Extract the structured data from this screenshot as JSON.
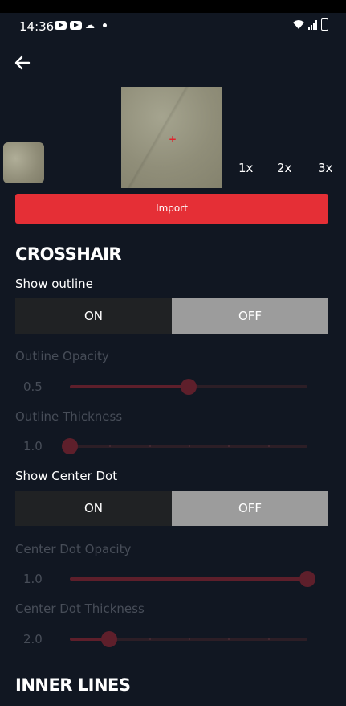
{
  "status_bar": {
    "time": "14:36"
  },
  "import_label": "Import",
  "zoom_options": [
    "1x",
    "2x",
    "3x"
  ],
  "crosshair": {
    "title": "CROSSHAIR",
    "show_outline": {
      "label": "Show outline",
      "on": "ON",
      "off": "OFF",
      "selected": "OFF"
    },
    "outline_opacity": {
      "label": "Outline Opacity",
      "value": "0.5",
      "fraction": 0.5
    },
    "outline_thickness": {
      "label": "Outline Thickness",
      "value": "1.0",
      "fraction": 0.0
    },
    "show_center_dot": {
      "label": "Show Center Dot",
      "on": "ON",
      "off": "OFF",
      "selected": "OFF"
    },
    "center_dot_opacity": {
      "label": "Center Dot Opacity",
      "value": "1.0",
      "fraction": 1.0
    },
    "center_dot_thickness": {
      "label": "Center Dot Thickness",
      "value": "2.0",
      "fraction": 0.167
    }
  },
  "inner_lines": {
    "title": "INNER LINES"
  },
  "colors": {
    "background": "#111722",
    "accent": "#e52f36",
    "toggle_on_bg": "#202224",
    "toggle_off_bg": "#9c9c9c",
    "slider_fill": "#5e1f2b",
    "disabled_text": "#474d58"
  },
  "icons": [
    "back-arrow-icon",
    "youtube-icon",
    "weather-icon",
    "wifi-icon",
    "signal-icon",
    "battery-icon"
  ]
}
